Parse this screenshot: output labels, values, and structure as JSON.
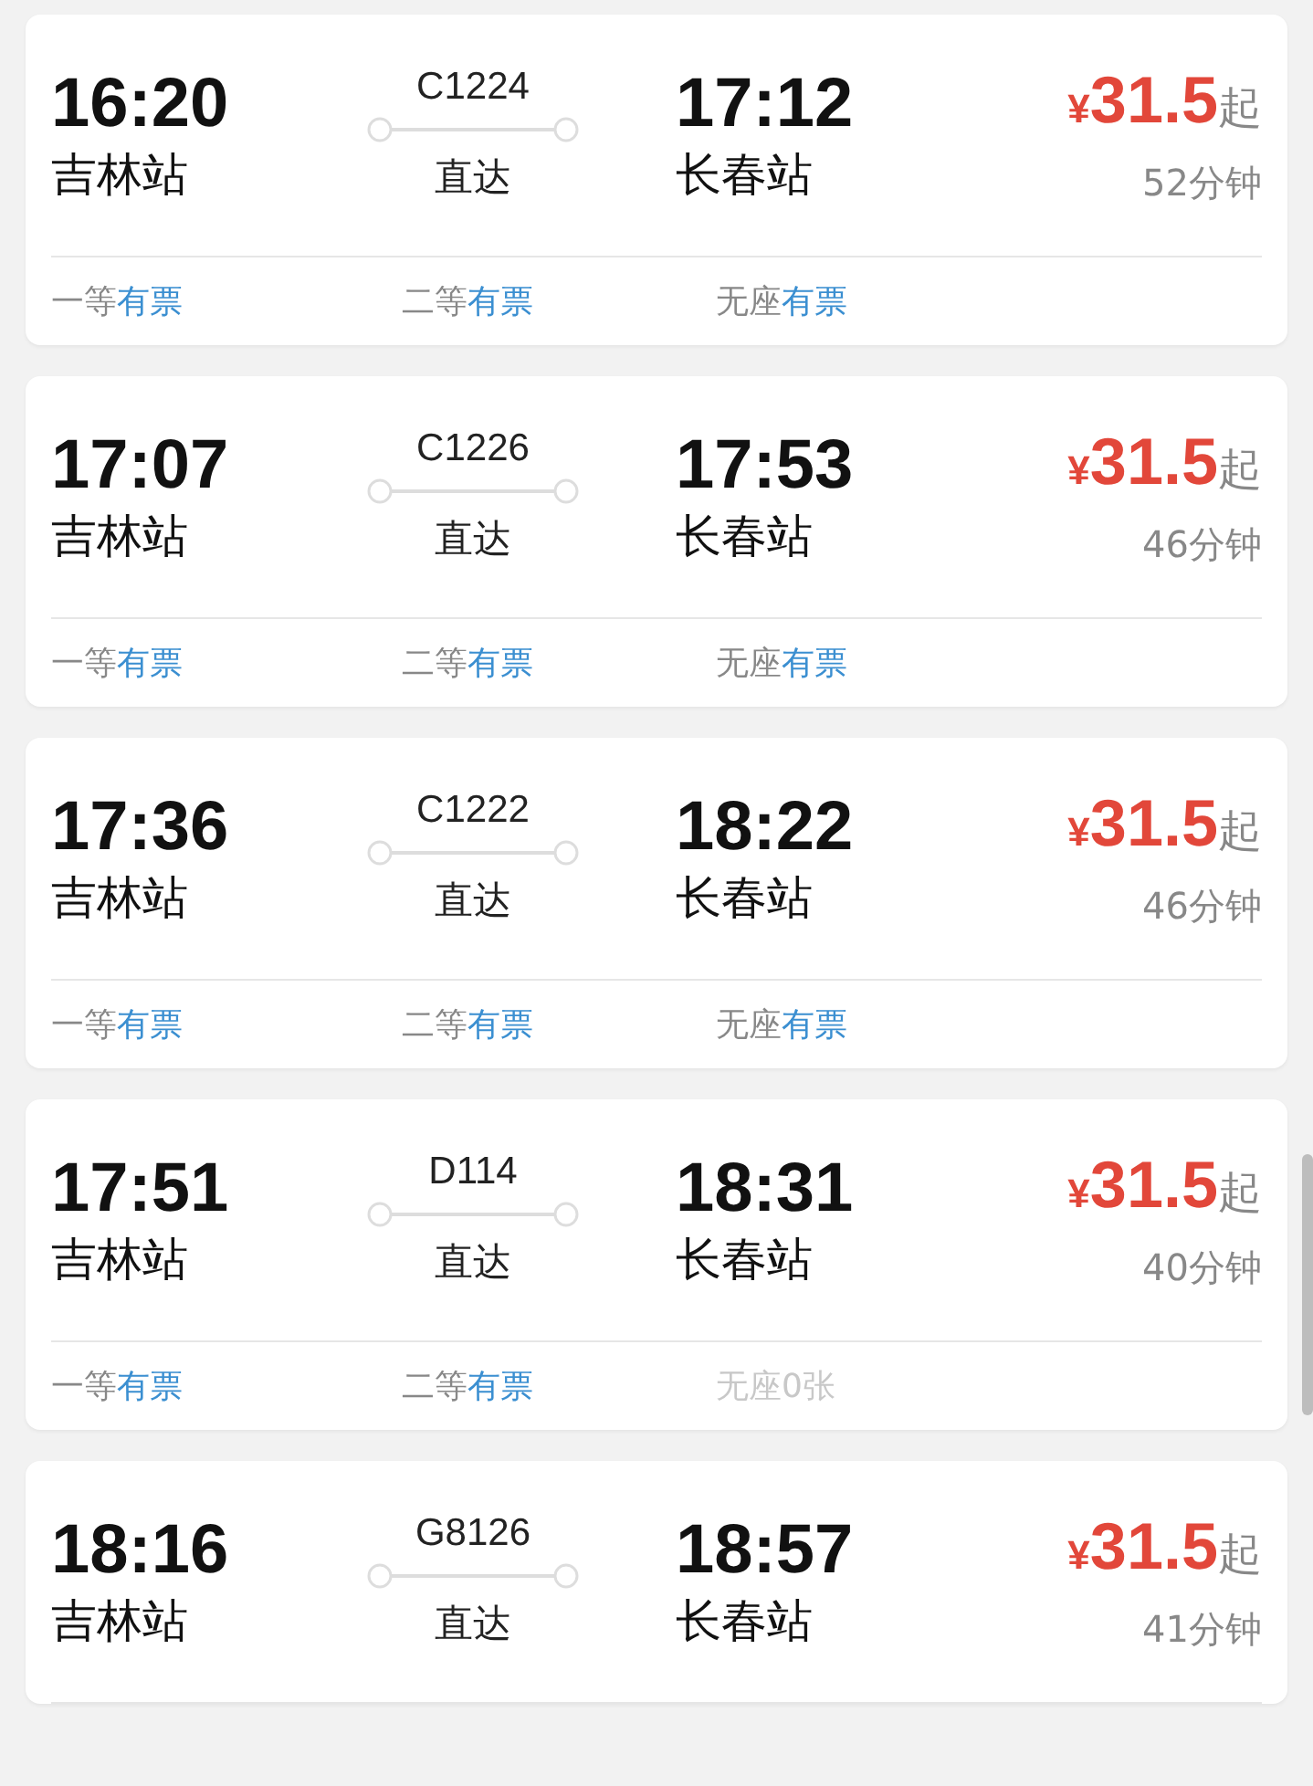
{
  "trains": [
    {
      "depart_time": "16:20",
      "depart_station": "吉林站",
      "train_no": "C1224",
      "route_type": "直达",
      "arrive_time": "17:12",
      "arrive_station": "长春站",
      "currency": "¥",
      "price": "31.5",
      "price_suffix": "起",
      "duration": "52分钟",
      "seats": [
        {
          "class": "一等",
          "status": "有票",
          "available": true
        },
        {
          "class": "二等",
          "status": "有票",
          "available": true
        },
        {
          "class": "无座",
          "status": "有票",
          "available": true
        }
      ]
    },
    {
      "depart_time": "17:07",
      "depart_station": "吉林站",
      "train_no": "C1226",
      "route_type": "直达",
      "arrive_time": "17:53",
      "arrive_station": "长春站",
      "currency": "¥",
      "price": "31.5",
      "price_suffix": "起",
      "duration": "46分钟",
      "seats": [
        {
          "class": "一等",
          "status": "有票",
          "available": true
        },
        {
          "class": "二等",
          "status": "有票",
          "available": true
        },
        {
          "class": "无座",
          "status": "有票",
          "available": true
        }
      ]
    },
    {
      "depart_time": "17:36",
      "depart_station": "吉林站",
      "train_no": "C1222",
      "route_type": "直达",
      "arrive_time": "18:22",
      "arrive_station": "长春站",
      "currency": "¥",
      "price": "31.5",
      "price_suffix": "起",
      "duration": "46分钟",
      "seats": [
        {
          "class": "一等",
          "status": "有票",
          "available": true
        },
        {
          "class": "二等",
          "status": "有票",
          "available": true
        },
        {
          "class": "无座",
          "status": "有票",
          "available": true
        }
      ]
    },
    {
      "depart_time": "17:51",
      "depart_station": "吉林站",
      "train_no": "D114",
      "route_type": "直达",
      "arrive_time": "18:31",
      "arrive_station": "长春站",
      "currency": "¥",
      "price": "31.5",
      "price_suffix": "起",
      "duration": "40分钟",
      "seats": [
        {
          "class": "一等",
          "status": "有票",
          "available": true
        },
        {
          "class": "二等",
          "status": "有票",
          "available": true
        },
        {
          "class": "无座",
          "status": "0张",
          "available": false
        }
      ]
    },
    {
      "depart_time": "18:16",
      "depart_station": "吉林站",
      "train_no": "G8126",
      "route_type": "直达",
      "arrive_time": "18:57",
      "arrive_station": "长春站",
      "currency": "¥",
      "price": "31.5",
      "price_suffix": "起",
      "duration": "41分钟"
    }
  ]
}
